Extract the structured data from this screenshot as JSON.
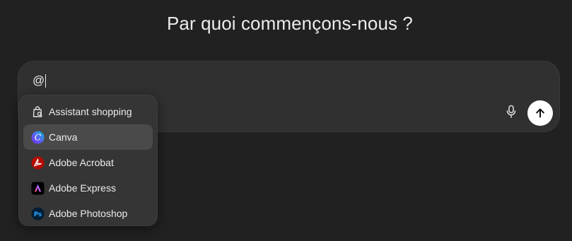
{
  "headline": "Par quoi commençons-nous ?",
  "composer": {
    "input_value": "@",
    "mic_icon": "microphone-icon",
    "send_icon": "arrow-up-icon"
  },
  "mention_menu": {
    "items": [
      {
        "label": "Assistant shopping",
        "icon": "shopping-bag-search-icon",
        "active": false
      },
      {
        "label": "Canva",
        "icon": "canva-logo-icon",
        "active": true
      },
      {
        "label": "Adobe Acrobat",
        "icon": "adobe-acrobat-icon",
        "active": false
      },
      {
        "label": "Adobe Express",
        "icon": "adobe-express-icon",
        "active": false
      },
      {
        "label": "Adobe Photoshop",
        "icon": "adobe-photoshop-icon",
        "active": false
      }
    ]
  },
  "colors": {
    "background": "#212121",
    "composer": "#303030",
    "menu": "#353535",
    "menu_active": "#4a4a4a",
    "send_button": "#ffffff"
  }
}
